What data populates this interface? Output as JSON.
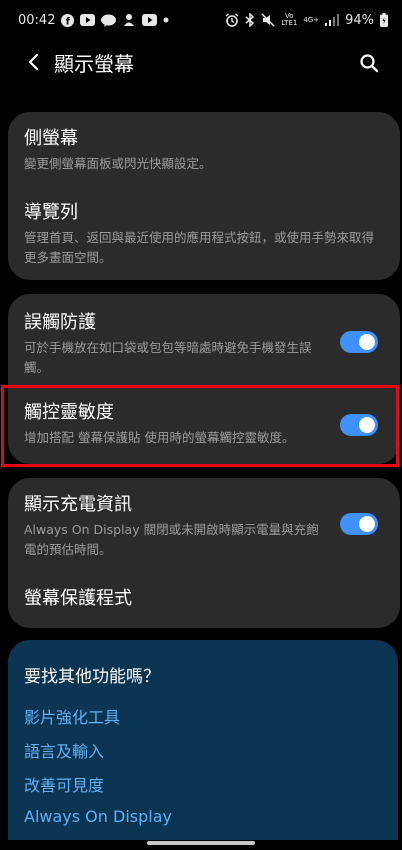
{
  "status_bar": {
    "time": "00:42",
    "network_volte": "Vo",
    "network_lte": "LTE1",
    "network_4g": "4G+",
    "battery": "94%"
  },
  "header": {
    "title": "顯示螢幕",
    "back_icon": "back-arrow-icon",
    "search_icon": "search-icon"
  },
  "card1": {
    "items": [
      {
        "title": "側螢幕",
        "subtitle": "變更側螢幕面板或閃光快顯設定。"
      },
      {
        "title": "導覽列",
        "subtitle": "管理首頁、返回與最近使用的應用程式按鈕，或使用手勢來取得更多畫面空間。"
      }
    ]
  },
  "card2": {
    "items": [
      {
        "title": "誤觸防護",
        "subtitle": "可於手機放在如口袋或包包等暗處時避免手機發生誤觸。",
        "toggle": true
      },
      {
        "title": "觸控靈敏度",
        "subtitle": "增加搭配 螢幕保護貼 使用時的螢幕觸控靈敏度。",
        "toggle": true
      }
    ]
  },
  "card3": {
    "items": [
      {
        "title": "顯示充電資訊",
        "subtitle": "Always On Display 關閉或未開啟時顯示電量與充飽電的預估時間。",
        "toggle": true
      },
      {
        "title": "螢幕保護程式"
      }
    ]
  },
  "suggestions": {
    "title": "要找其他功能嗎？",
    "links": [
      "影片強化工具",
      "語言及輸入",
      "改善可見度",
      "Always On Display"
    ]
  },
  "colors": {
    "accent": "#3e91ff",
    "highlight": "#e50914",
    "card_bg": "#2b2b2b",
    "suggestion_bg": "#0c3553",
    "link": "#62b0f5"
  }
}
